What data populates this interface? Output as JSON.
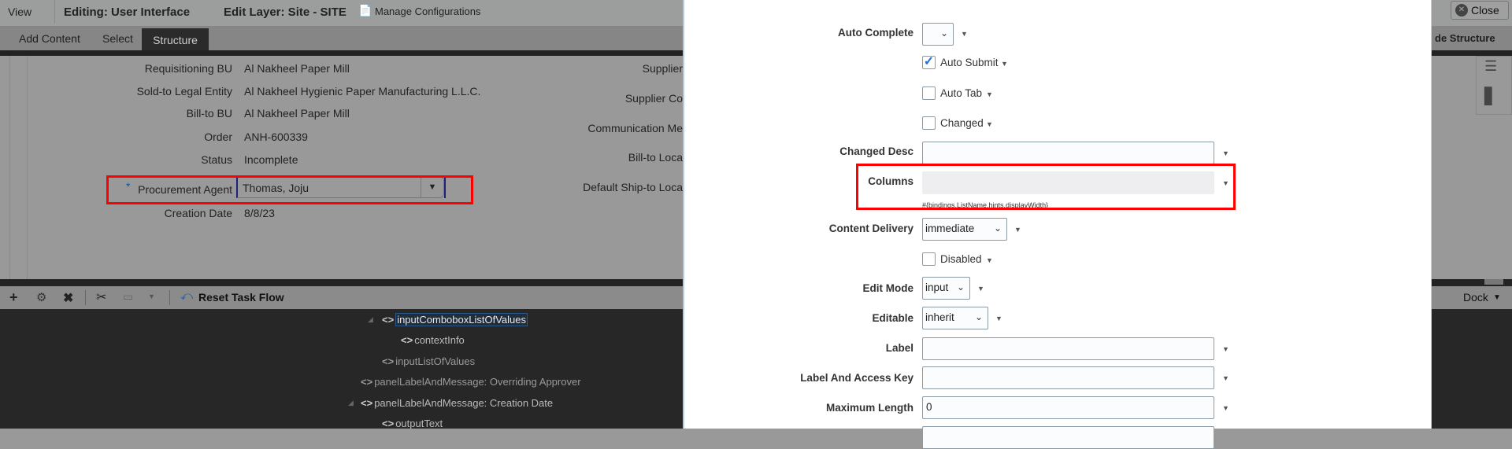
{
  "topbar": {
    "view": "View",
    "editing": "Editing: User Interface",
    "edit_layer": "Edit Layer: Site - SITE",
    "manage_configurations": "Manage Configurations",
    "close": "Close"
  },
  "tabs": {
    "add_content": "Add Content",
    "select": "Select",
    "structure": "Structure",
    "hide_structure": "de Structure"
  },
  "form": {
    "left": [
      {
        "label": "Requisitioning BU",
        "value": "Al Nakheel Paper Mill"
      },
      {
        "label": "Sold-to Legal Entity",
        "value": "Al Nakheel Hygienic Paper Manufacturing L.L.C."
      },
      {
        "label": "Bill-to BU",
        "value": "Al Nakheel Paper Mill"
      },
      {
        "label": "Order",
        "value": "ANH-600339"
      },
      {
        "label": "Status",
        "value": "Incomplete"
      },
      {
        "label": "Procurement Agent",
        "value": "Thomas, Joju",
        "required": "*"
      },
      {
        "label": "Creation Date",
        "value": "8/8/23"
      }
    ],
    "right": [
      "Supplier",
      "Supplier Co",
      "Communication Me",
      "Bill-to Loca",
      "Default Ship-to Loca"
    ]
  },
  "toolbar": {
    "reset_task_flow": "Reset Task Flow",
    "dock": "Dock"
  },
  "tree": [
    {
      "label": "inputComboboxListOfValues",
      "selected": true
    },
    {
      "label": "contextInfo"
    },
    {
      "label": "inputListOfValues"
    },
    {
      "label": "panelLabelAndMessage: Overriding Approver"
    },
    {
      "label": "panelLabelAndMessage: Creation Date"
    },
    {
      "label": "outputText"
    }
  ],
  "dialog": {
    "auto_complete": {
      "label": "Auto Complete",
      "value": ""
    },
    "auto_submit": {
      "label": "Auto Submit",
      "checked": true
    },
    "auto_tab": {
      "label": "Auto Tab",
      "checked": false
    },
    "changed": {
      "label": "Changed",
      "checked": false
    },
    "changed_desc": {
      "label": "Changed Desc",
      "value": ""
    },
    "columns": {
      "label": "Columns",
      "value": "",
      "hint": "#{bindings.ListName.hints.displayWidth}"
    },
    "content_delivery": {
      "label": "Content Delivery",
      "value": "immediate"
    },
    "disabled": {
      "label": "Disabled",
      "checked": false
    },
    "edit_mode": {
      "label": "Edit Mode",
      "value": "input"
    },
    "editable": {
      "label": "Editable",
      "value": "inherit"
    },
    "label": {
      "label": "Label",
      "value": ""
    },
    "label_access_key": {
      "label": "Label And Access Key",
      "value": ""
    },
    "maximum_length": {
      "label": "Maximum Length",
      "value": "0"
    }
  },
  "colors": {
    "highlight": "#ff0000",
    "check": "#1e6fd0"
  }
}
